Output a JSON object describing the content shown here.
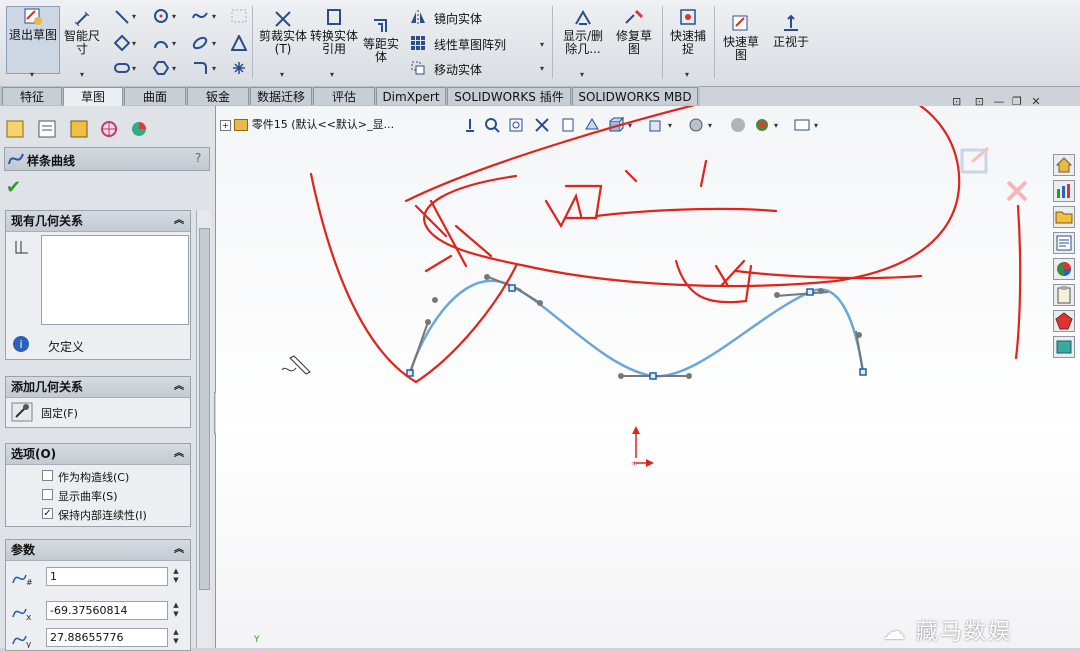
{
  "ribbon": {
    "exit_sketch": "退出草图",
    "smart_dim": "智能尺寸",
    "trim": "剪裁实体(T)",
    "convert": "转换实体引用",
    "offset": "等距实体",
    "mirror": "镜向实体",
    "linear_pattern": "线性草图阵列",
    "move": "移动实体",
    "show_delete": "显示/删除几...",
    "repair": "修复草图",
    "quick_snap": "快速捕捉",
    "rapid_sketch": "快速草图",
    "normal_to": "正视于"
  },
  "tabs": [
    "特征",
    "草图",
    "曲面",
    "钣金",
    "数据迁移",
    "评估",
    "DimXpert",
    "SOLIDWORKS 插件",
    "SOLIDWORKS MBD"
  ],
  "active_tab": "草图",
  "panel": {
    "title": "样条曲线",
    "help": "?",
    "existing_relations": "现有几何关系",
    "status": "欠定义",
    "add_relations": "添加几何关系",
    "fix": "固定(F)",
    "options": "选项(O)",
    "opt_construction": "作为构造线(C)",
    "opt_curvature": "显示曲率(S)",
    "opt_continuity": "保持内部连续性(I)",
    "params": "参数",
    "param1": "1",
    "param2": "-69.37560814",
    "param3": "27.88655776"
  },
  "viewport": {
    "tree_label": "零件15 (默认<<默认>_显..."
  },
  "watermark": "藏马数娱",
  "colors": {
    "spline": "#6aa6d8",
    "annotation": "#e0231b",
    "accent": "#1f5fa8"
  }
}
